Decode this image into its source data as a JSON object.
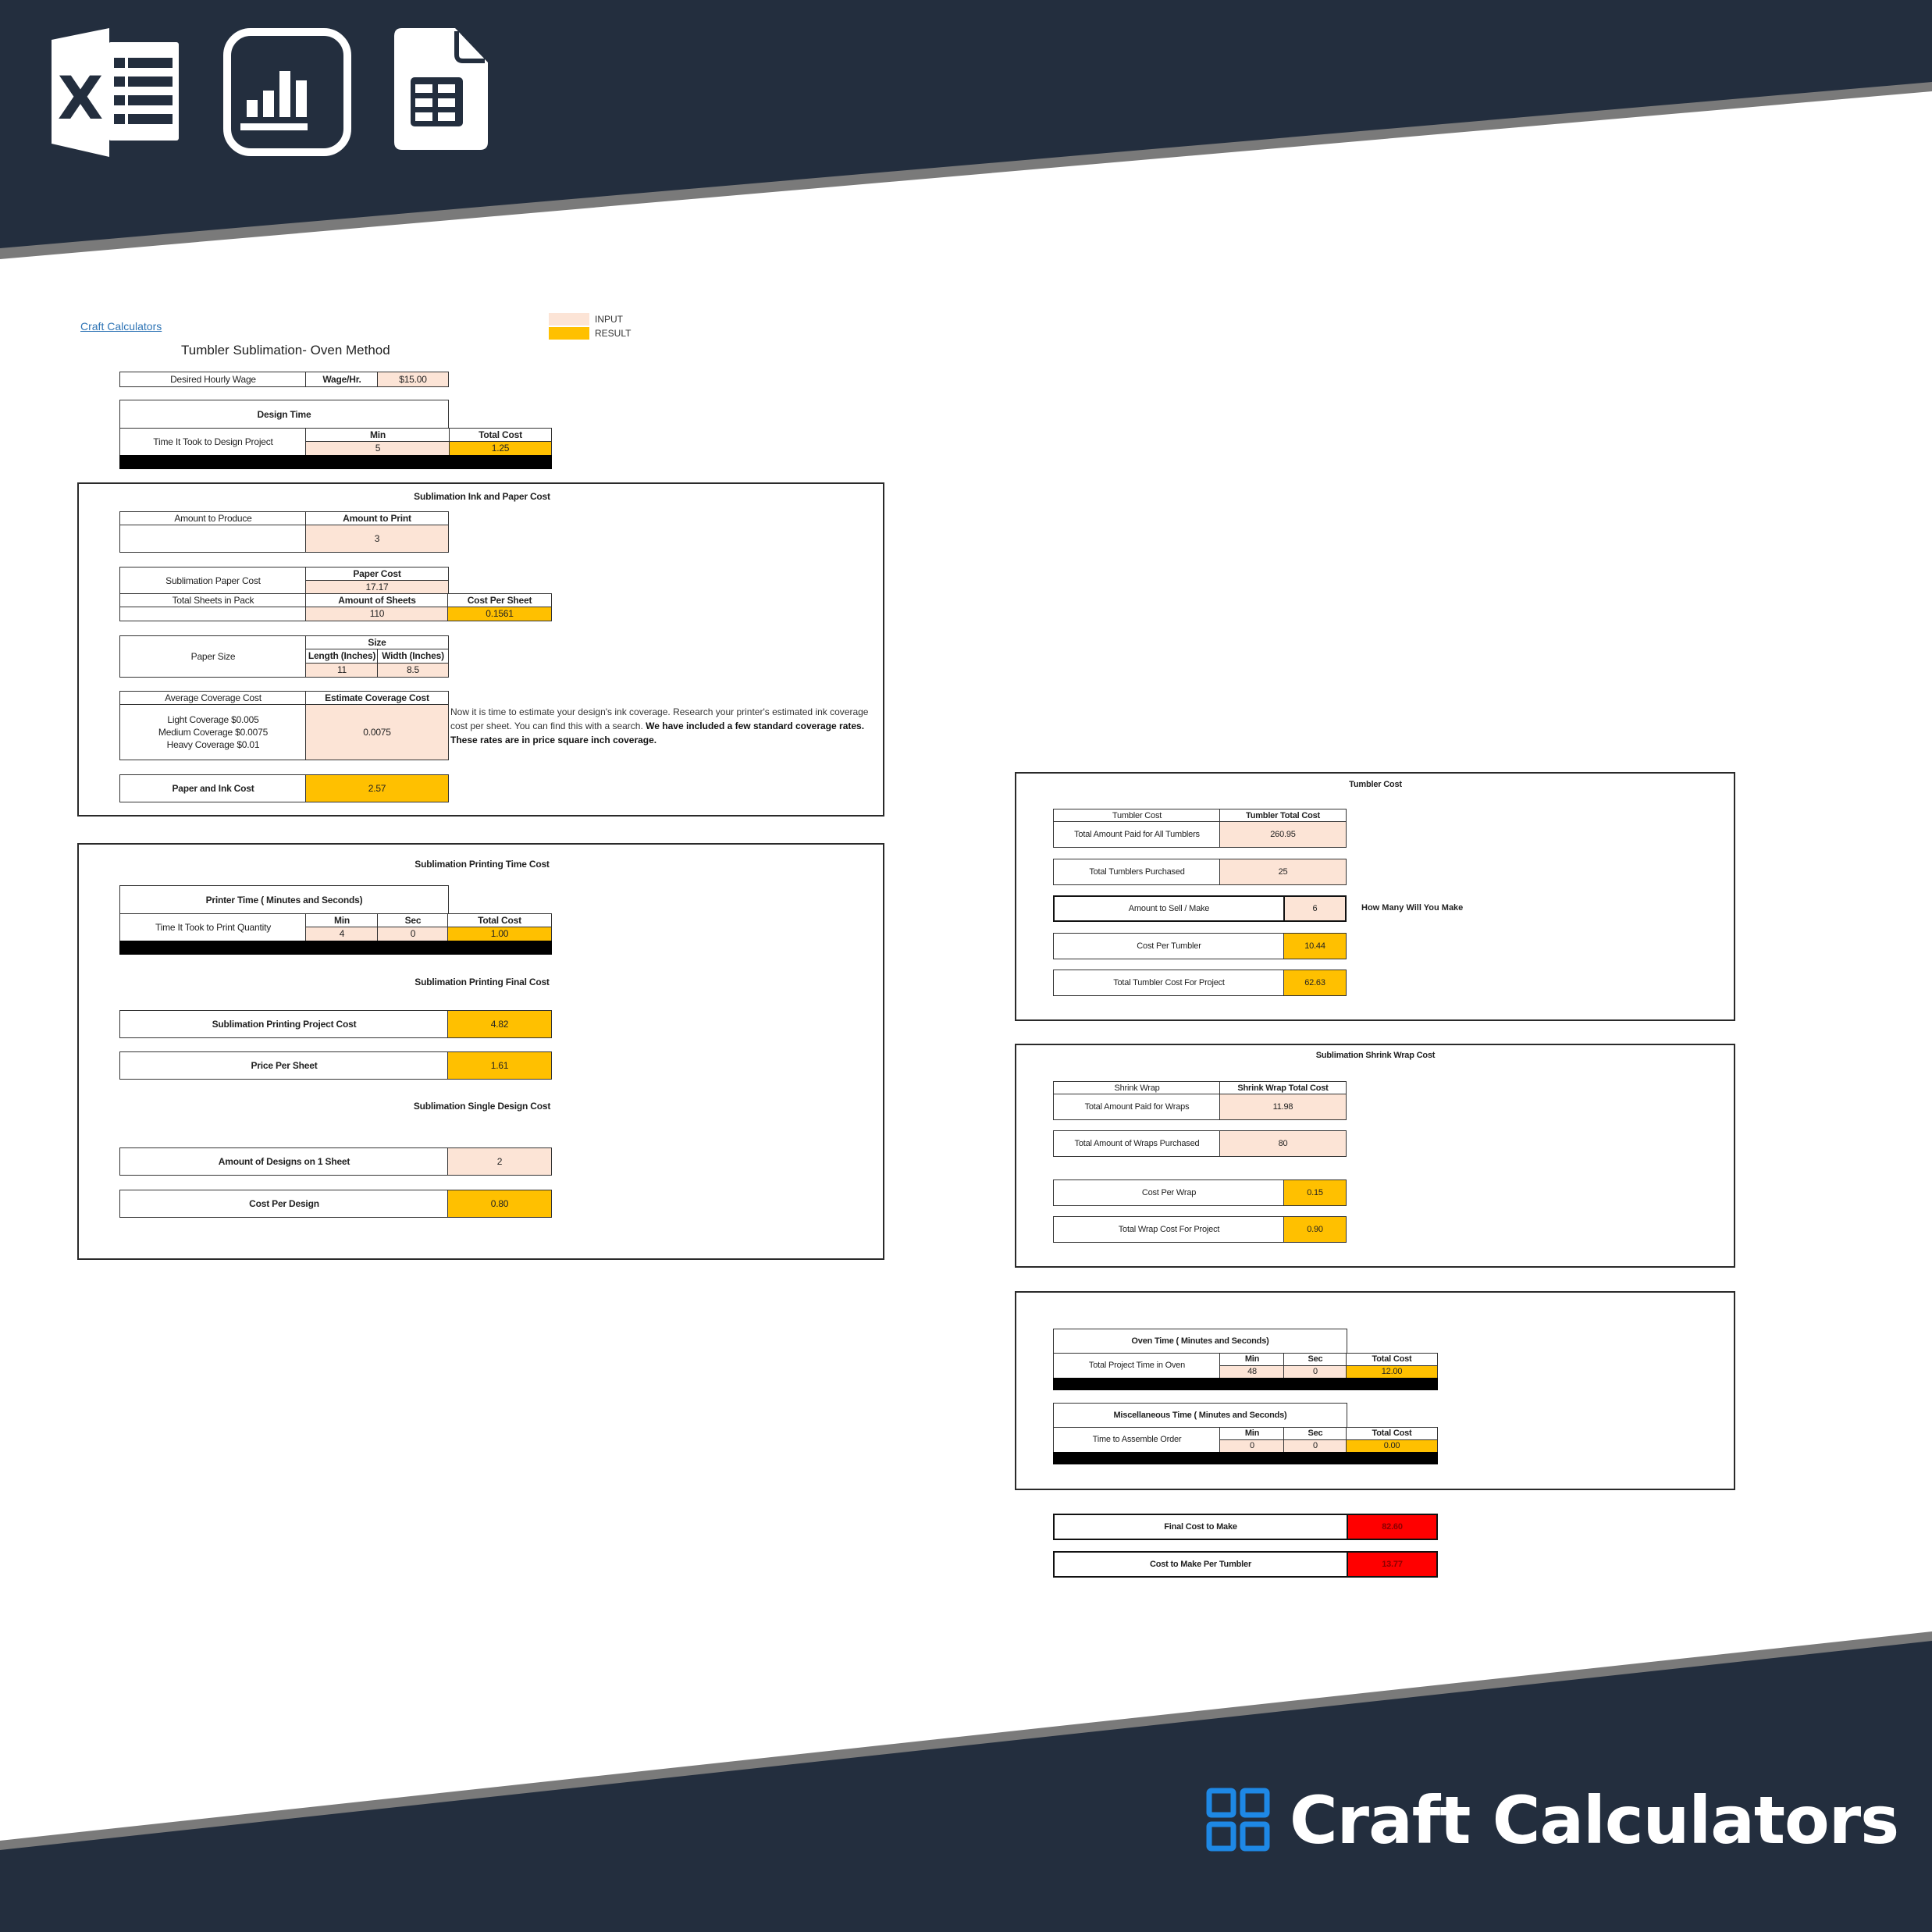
{
  "colors": {
    "banner": "#232e3e",
    "banner_edge": "#7a7a7a",
    "input": "#fce4d6",
    "result": "#ffc000",
    "final": "#ff0000",
    "link": "#2e74b5",
    "brand_icon": "#1e88e5"
  },
  "top_icons": [
    "excel-icon",
    "bar-chart-icon",
    "spreadsheet-file-icon"
  ],
  "sheet": {
    "link_label": "Craft Calculators",
    "title": "Tumbler Sublimation- Oven Method",
    "legend": {
      "input_label": "INPUT",
      "result_label": "RESULT"
    }
  },
  "wage": {
    "label": "Desired Hourly Wage",
    "unit_label": "Wage/Hr.",
    "value": "$15.00"
  },
  "design_time": {
    "title": "Design Time",
    "row_label": "Time It Took to Design Project",
    "min_header": "Min",
    "total_header": "Total Cost",
    "min_value": "5",
    "total_value": "1.25"
  },
  "ink_paper": {
    "title": "Sublimation Ink and Paper Cost",
    "amount_to_produce_label": "Amount to Produce",
    "amount_to_print_header": "Amount to Print",
    "amount_to_print_value": "3",
    "paper_cost_label": "Sublimation Paper Cost",
    "paper_cost_header": "Paper Cost",
    "paper_cost_value": "17.17",
    "total_sheets_label": "Total Sheets in Pack",
    "amount_sheets_header": "Amount of Sheets",
    "amount_sheets_value": "110",
    "cost_per_sheet_header": "Cost Per Sheet",
    "cost_per_sheet_value": "0.1561",
    "paper_size_label": "Paper Size",
    "size_header": "Size",
    "length_header": "Length (Inches)",
    "width_header": "Width (Inches)",
    "length_value": "11",
    "width_value": "8.5",
    "avg_coverage_header": "Average Coverage Cost",
    "estimate_coverage_header": "Estimate Coverage Cost",
    "coverage_options": [
      "Light Coverage $0.005",
      "Medium Coverage $0.0075",
      "Heavy Coverage $0.01"
    ],
    "estimate_coverage_value": "0.0075",
    "note_plain": "Now it is time to estimate your design's ink coverage. Research your printer's estimated ink coverage cost per sheet. You can find this with a search. ",
    "note_bold": "We have included a few standard coverage rates. These rates are in price square inch coverage.",
    "paper_ink_label": "Paper and Ink Cost",
    "paper_ink_value": "2.57"
  },
  "printing": {
    "time_title": "Sublimation Printing Time Cost",
    "printer_time_header": "Printer Time ( Minutes and Seconds)",
    "row_label": "Time It Took to Print Quantity",
    "min_header": "Min",
    "sec_header": "Sec",
    "total_header": "Total Cost",
    "min_value": "4",
    "sec_value": "0",
    "total_value": "1.00",
    "final_title": "Sublimation Printing Final Cost",
    "project_cost_label": "Sublimation Printing Project Cost",
    "project_cost_value": "4.82",
    "price_per_sheet_label": "Price Per Sheet",
    "price_per_sheet_value": "1.61",
    "single_design_title": "Sublimation Single Design Cost",
    "designs_per_sheet_label": "Amount of Designs on 1 Sheet",
    "designs_per_sheet_value": "2",
    "cost_per_design_label": "Cost Per Design",
    "cost_per_design_value": "0.80"
  },
  "tumbler": {
    "title": "Tumbler Cost",
    "col1_header": "Tumbler Cost",
    "col2_header": "Tumbler Total Cost",
    "paid_label": "Total Amount Paid for All Tumblers",
    "paid_value": "260.95",
    "purchased_label": "Total Tumblers Purchased",
    "purchased_value": "25",
    "sell_label": "Amount to Sell / Make",
    "sell_value": "6",
    "sell_note": "How Many Will You Make",
    "per_tumbler_label": "Cost Per Tumbler",
    "per_tumbler_value": "10.44",
    "project_label": "Total Tumbler Cost For Project",
    "project_value": "62.63"
  },
  "shrink_wrap": {
    "title": "Sublimation Shrink Wrap Cost",
    "col1_header": "Shrink Wrap",
    "col2_header": "Shrink Wrap Total Cost",
    "paid_label": "Total Amount Paid for Wraps",
    "paid_value": "11.98",
    "purchased_label": "Total Amount of Wraps Purchased",
    "purchased_value": "80",
    "per_wrap_label": "Cost Per Wrap",
    "per_wrap_value": "0.15",
    "project_label": "Total Wrap Cost For Project",
    "project_value": "0.90"
  },
  "oven": {
    "header": "Oven Time ( Minutes and Seconds)",
    "row_label": "Total Project Time in Oven",
    "min_header": "Min",
    "sec_header": "Sec",
    "total_header": "Total Cost",
    "min_value": "48",
    "sec_value": "0",
    "total_value": "12.00"
  },
  "misc": {
    "header": "Miscellaneous Time ( Minutes and Seconds)",
    "row_label": "Time to Assemble Order",
    "min_header": "Min",
    "sec_header": "Sec",
    "total_header": "Total Cost",
    "min_value": "0",
    "sec_value": "0",
    "total_value": "0.00"
  },
  "final": {
    "cost_to_make_label": "Final Cost to Make",
    "cost_to_make_value": "82.60",
    "per_tumbler_label": "Cost to Make Per Tumbler",
    "per_tumbler_value": "13.77"
  },
  "brand": {
    "name": "Craft Calculators"
  }
}
